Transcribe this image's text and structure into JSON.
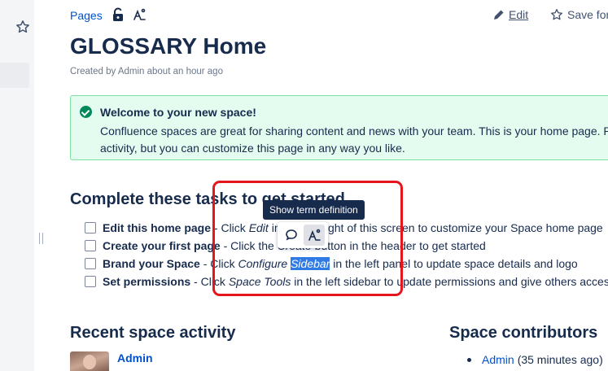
{
  "header": {
    "breadcrumb": "Pages",
    "edit_label": "Edit",
    "save_label": "Save for"
  },
  "page": {
    "title": "GLOSSARY Home",
    "byline": "Created by Admin about an hour ago"
  },
  "panel": {
    "title": "Welcome to your new space!",
    "body": "Confluence spaces are great for sharing content and news with your team. This is your home page. Ri activity, but you can customize this page in any way you like."
  },
  "tasks": {
    "heading": "Complete these tasks to get started",
    "items": [
      {
        "bold": "Edit this home page",
        "text1": " - Click ",
        "italic": "Edit",
        "text2": " in the top right of this screen to customize your Space home page"
      },
      {
        "bold": "Create your first page",
        "text1": " - Click the ",
        "italic": "Create",
        "text2": " button in the header to get started"
      },
      {
        "bold": "Brand your Space",
        "text1": " - Click ",
        "italic_pre": "Configure ",
        "selected": "Sidebar",
        "text2": " in the left panel to update space details and logo"
      },
      {
        "bold": "Set permissions",
        "text1": " - Click ",
        "italic": "Space Tools",
        "text2": " in the left sidebar to update permissions and give others access"
      }
    ]
  },
  "popup": {
    "tooltip": "Show term definition"
  },
  "activity": {
    "heading": "Recent space activity",
    "user": "Admin"
  },
  "contributors": {
    "heading": "Space contributors",
    "items": [
      {
        "name": "Admin",
        "when": "(35 minutes ago)"
      }
    ]
  },
  "colors": {
    "link": "#0052cc",
    "text": "#172b4d",
    "success_panel": "#e3fcef",
    "success_icon": "#00875a",
    "selection": "#2f7ae5",
    "highlight_box": "#e5151c",
    "tooltip_bg": "#172b4d"
  },
  "icons": {
    "sidebar": "star-icon",
    "restrictions": "unlock-icon",
    "definitions": "term-definition-icon",
    "edit": "pencil-icon",
    "save": "star-outline-icon",
    "comment": "comment-icon",
    "panel": "check-circle-icon"
  }
}
